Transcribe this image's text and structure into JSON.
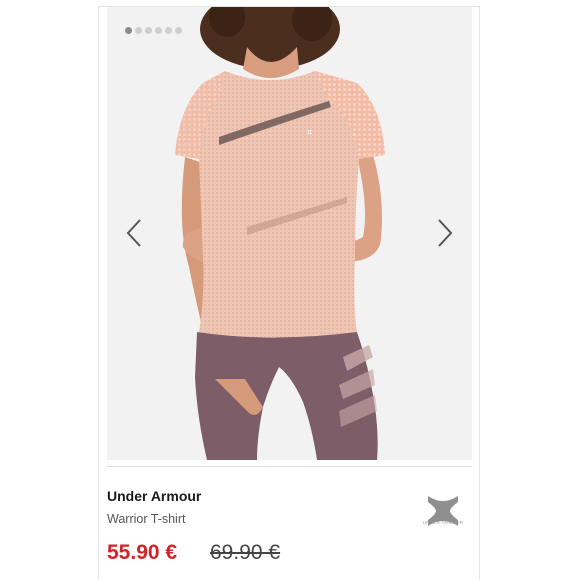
{
  "gallery": {
    "total_images": 6,
    "active_index": 0,
    "prev_icon": "chevron-left-icon",
    "next_icon": "chevron-right-icon"
  },
  "product": {
    "brand": "Under Armour",
    "name": "Warrior T-shirt",
    "price_current": "55.90 €",
    "price_original": "69.90 €",
    "logo_caption": "UNDER ARMOUR"
  },
  "colors": {
    "price_red": "#d0232b",
    "shirt_pink": "#f0c7b4",
    "leggings_mauve": "#7a5c66"
  }
}
